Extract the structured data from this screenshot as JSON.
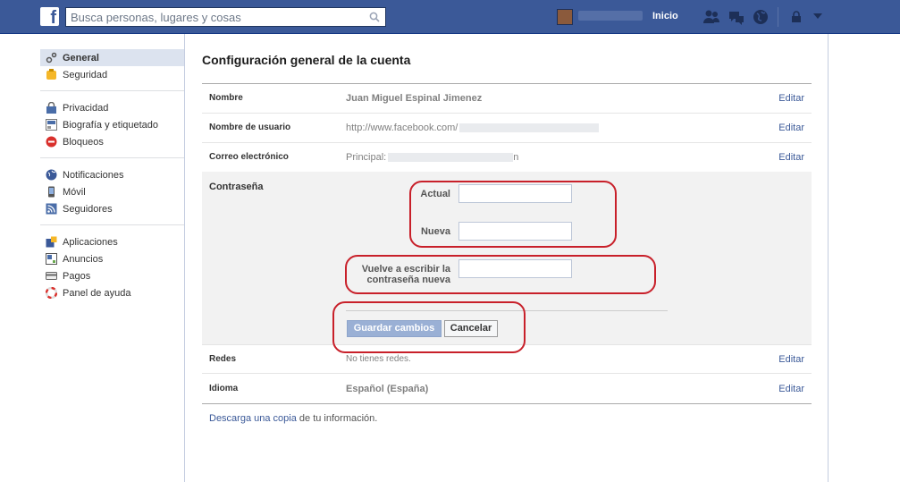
{
  "header": {
    "logo": "f",
    "search_placeholder": "Busca personas, lugares y cosas",
    "home_label": "Inicio",
    "icons": [
      "friends-icon",
      "messages-icon",
      "globe-icon",
      "lock-icon",
      "chevron-down-icon"
    ]
  },
  "sidebar": {
    "groups": [
      {
        "items": [
          {
            "label": "General",
            "icon": "gear-icon",
            "active": true
          },
          {
            "label": "Seguridad",
            "icon": "badge-icon"
          }
        ]
      },
      {
        "items": [
          {
            "label": "Privacidad",
            "icon": "lock-icon"
          },
          {
            "label": "Biografía y etiquetado",
            "icon": "timeline-icon"
          },
          {
            "label": "Bloqueos",
            "icon": "block-icon"
          }
        ]
      },
      {
        "items": [
          {
            "label": "Notificaciones",
            "icon": "globe-icon"
          },
          {
            "label": "Móvil",
            "icon": "mobile-icon"
          },
          {
            "label": "Seguidores",
            "icon": "rss-icon"
          }
        ]
      },
      {
        "items": [
          {
            "label": "Aplicaciones",
            "icon": "apps-icon"
          },
          {
            "label": "Anuncios",
            "icon": "ads-icon"
          },
          {
            "label": "Pagos",
            "icon": "card-icon"
          },
          {
            "label": "Panel de ayuda",
            "icon": "lifebuoy-icon"
          }
        ]
      }
    ]
  },
  "main": {
    "title": "Configuración general de la cuenta",
    "edit_label": "Editar",
    "rows": {
      "name": {
        "label": "Nombre",
        "value": "Juan Miguel Espinal Jimenez"
      },
      "username": {
        "label": "Nombre de usuario",
        "value": "http://www.facebook.com/"
      },
      "email": {
        "label": "Correo electrónico",
        "value": "Principal:",
        "value_suffix": "n"
      },
      "networks": {
        "label": "Redes",
        "value": "No tienes redes."
      },
      "language": {
        "label": "Idioma",
        "value": "Español (España)"
      }
    },
    "password": {
      "label": "Contraseña",
      "current_label": "Actual",
      "new_label": "Nueva",
      "confirm_label_line1": "Vuelve a escribir la",
      "confirm_label_line2": "contraseña nueva",
      "save_label": "Guardar cambios",
      "cancel_label": "Cancelar"
    },
    "download": {
      "link_text": "Descarga una copia",
      "rest_text": " de tu información."
    }
  },
  "colors": {
    "brand": "#3b5998",
    "annotation": "#c8202a"
  }
}
